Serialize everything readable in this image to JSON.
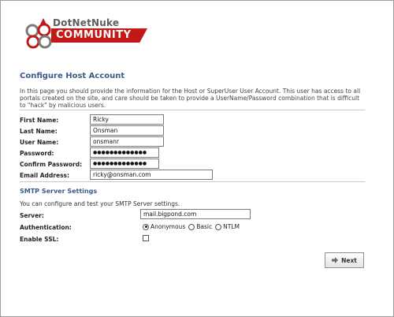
{
  "logo": {
    "brand": "DotNetNuke",
    "edition": "COMMUNITY",
    "brand_color": "#c31818"
  },
  "page": {
    "title": "Configure Host Account",
    "intro": "In this page you should provide the information for the Host or SuperUser User Account. This user has access to all portals created on the site, and care should be taken to provide a UserName/Password combination that is difficult to \"hack\" by malicious users."
  },
  "form": {
    "first_name_label": "First Name:",
    "first_name_value": "Ricky",
    "last_name_label": "Last Name:",
    "last_name_value": "Onsman",
    "user_name_label": "User Name:",
    "user_name_value": "onsmanr",
    "password_label": "Password:",
    "password_value": "●●●●●●●●●●●●●",
    "confirm_password_label": "Confirm Password:",
    "confirm_password_value": "●●●●●●●●●●●●●",
    "email_label": "Email Address:",
    "email_value": "ricky@onsman.com"
  },
  "smtp": {
    "title": "SMTP Server Settings",
    "note": "You can configure and test your SMTP Server settings.",
    "server_label": "Server:",
    "server_value": "mail.bigpond.com",
    "auth_label": "Authentication:",
    "auth_options": [
      "Anonymous",
      "Basic",
      "NTLM"
    ],
    "auth_selected": "Anonymous",
    "ssl_label": "Enable SSL:"
  },
  "buttons": {
    "next": "Next"
  },
  "colors": {
    "heading": "#3a5a8a"
  },
  "icons": {
    "next_icon": "arrow-right-icon"
  }
}
